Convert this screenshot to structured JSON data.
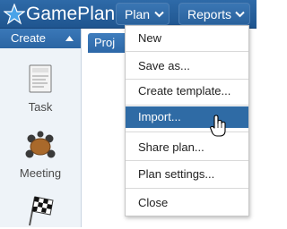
{
  "app": {
    "title": "GamePlan"
  },
  "top_menu": {
    "plan_label": "Plan",
    "reports_label": "Reports"
  },
  "sidebar": {
    "header_label": "Create",
    "tools": [
      {
        "label": "Task",
        "icon": "task-icon"
      },
      {
        "label": "Meeting",
        "icon": "meeting-icon"
      },
      {
        "label": "",
        "icon": "checkered-flag-icon"
      }
    ]
  },
  "main": {
    "tab_label": "Proj"
  },
  "plan_menu": {
    "items": [
      {
        "label": "New"
      },
      {
        "label": "Save as..."
      },
      {
        "label": "Create template..."
      },
      {
        "label": "Import..."
      },
      {
        "label": "Share plan..."
      },
      {
        "label": "Plan settings..."
      },
      {
        "label": "Close"
      }
    ],
    "hovered_item": "Import..."
  },
  "colors": {
    "topbar": "#2a629d",
    "menu_highlight": "#2f6ba5",
    "sidebar_bg": "#eef3f8"
  }
}
